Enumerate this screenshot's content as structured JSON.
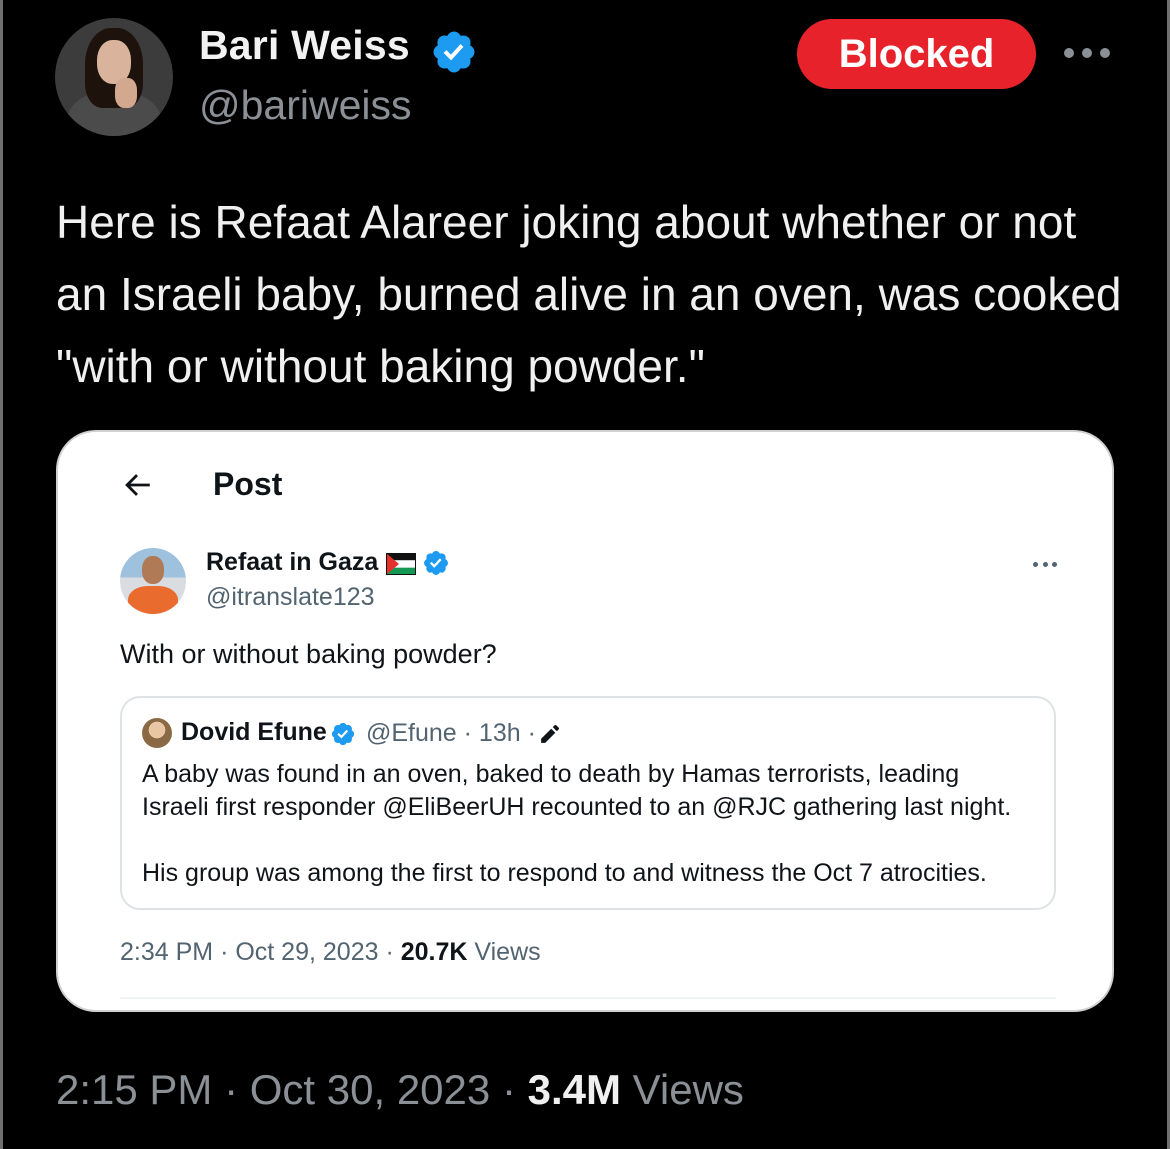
{
  "tweet": {
    "author_name": "Bari Weiss",
    "author_handle": "@bariweiss",
    "blocked_label": "Blocked",
    "text": "Here is Refaat Alareer joking about whether or not an Israeli baby, burned alive in an oven, was cooked \"with or without baking powder.\"",
    "time": "2:15 PM",
    "date": "Oct 30, 2023",
    "views_count": "3.4M",
    "views_label": "Views",
    "separator": "·"
  },
  "embedded": {
    "header_title": "Post",
    "author_name": "Refaat in Gaza",
    "author_handle": "@itranslate123",
    "text": "With or without baking powder?",
    "time": "2:34 PM",
    "date": "Oct 29, 2023",
    "views_count": "20.7K",
    "views_label": "Views",
    "quote": {
      "author_name": "Dovid Efune",
      "meta": "@Efune · 13h ·",
      "paragraph1": "A baby was found in an oven, baked to death by Hamas terrorists, leading Israeli first responder @EliBeerUH recounted to an @RJC gathering last night.",
      "paragraph2": "His group was among the first to respond to and witness the Oct 7 atrocities."
    }
  },
  "colors": {
    "background": "#000000",
    "blocked_red": "#e7222b",
    "verified_blue": "#1d9bf0",
    "muted_text": "#8b9096"
  },
  "icons": [
    "verified-badge-icon",
    "more-options-icon",
    "back-arrow-icon",
    "palestine-flag-icon",
    "pencil-edit-icon"
  ]
}
